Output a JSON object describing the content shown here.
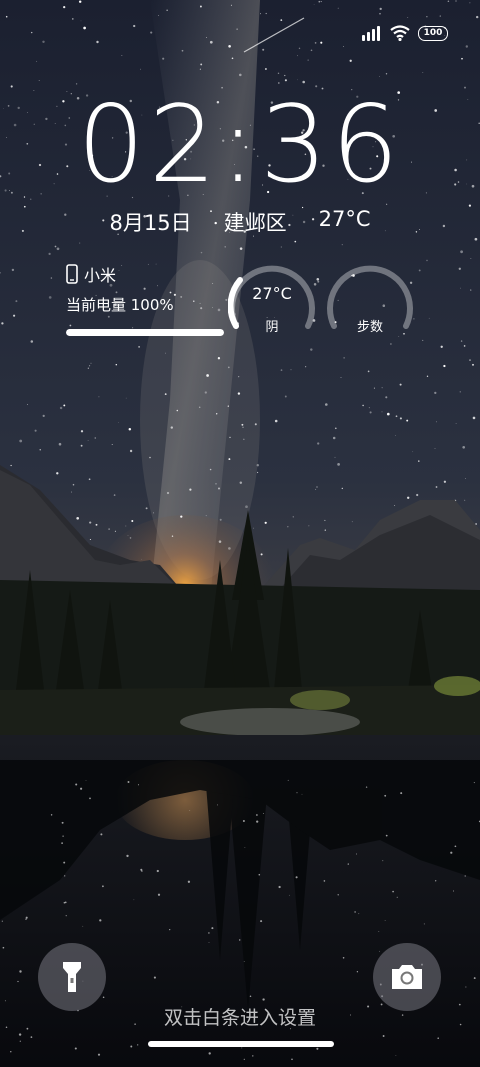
{
  "status_bar": {
    "battery_level": "100"
  },
  "clock": {
    "time": "02:36"
  },
  "date_row": {
    "date": "8月15日",
    "location": "建邺区",
    "temperature": "27°C"
  },
  "device_widget": {
    "name": "小米",
    "charge_label": "当前电量 100%",
    "charge_level": 1.0
  },
  "weather_widget": {
    "temperature": "27°C",
    "condition": "阴"
  },
  "steps_widget": {
    "label": "步数"
  },
  "bottom": {
    "hint": "双击白条进入设置"
  },
  "icons": {
    "signal": "signal-icon",
    "wifi": "wifi-icon",
    "battery": "battery-icon",
    "phone": "phone-icon",
    "flashlight": "flashlight-icon",
    "camera": "camera-icon"
  }
}
